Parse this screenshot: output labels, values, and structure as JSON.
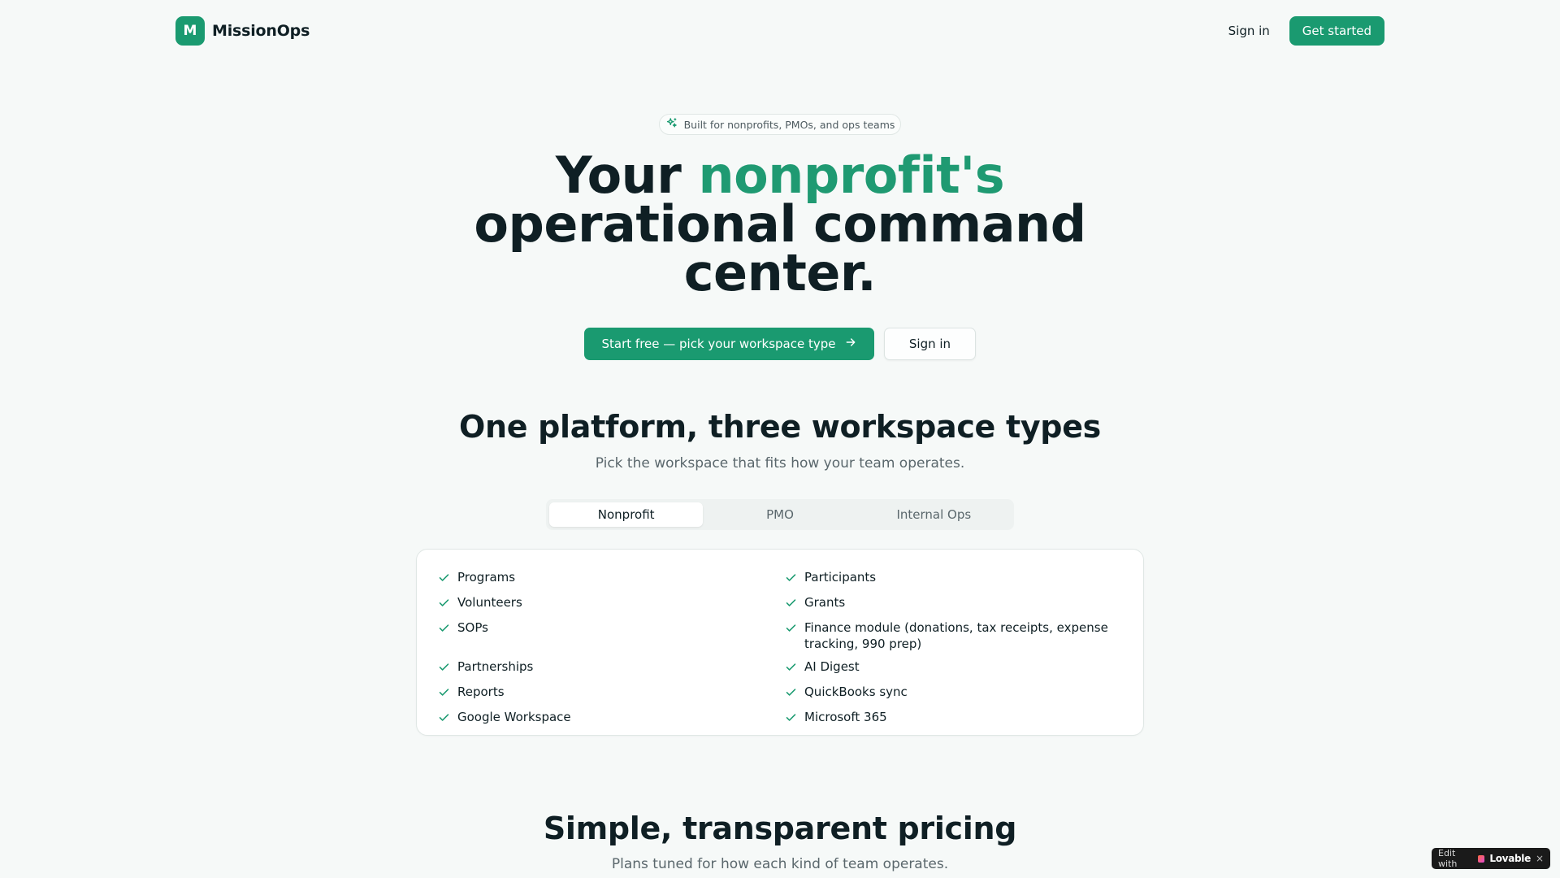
{
  "colors": {
    "accent": "#1a9a70",
    "text": "#0f1f24",
    "muted": "#5a676c",
    "background": "#f6f9f8"
  },
  "header": {
    "brand_initial": "M",
    "brand_name": "MissionOps",
    "sign_in": "Sign in",
    "get_started": "Get started"
  },
  "hero": {
    "badge_icon": "sparkles-icon",
    "badge": "Built for nonprofits, PMOs, and ops teams",
    "title_prefix": "Your ",
    "title_accent": "nonprofit's",
    "title_line2": "operational command",
    "title_line3": "center.",
    "cta_primary": "Start free — pick your workspace type",
    "cta_primary_icon": "arrow-right-icon",
    "cta_secondary": "Sign in"
  },
  "workspace": {
    "title": "One platform, three workspace types",
    "subtitle": "Pick the workspace that fits how your team operates.",
    "tabs": [
      {
        "label": "Nonprofit",
        "active": true
      },
      {
        "label": "PMO",
        "active": false
      },
      {
        "label": "Internal Ops",
        "active": false
      }
    ],
    "feature_icon": "check-icon",
    "features": [
      "Programs",
      "Participants",
      "Volunteers",
      "Grants",
      "SOPs",
      "Finance module (donations, tax receipts, expense tracking, 990 prep)",
      "Partnerships",
      "AI Digest",
      "Reports",
      "QuickBooks sync",
      "Google Workspace",
      "Microsoft 365"
    ]
  },
  "pricing": {
    "title": "Simple, transparent pricing",
    "subtitle": "Plans tuned for how each kind of team operates."
  },
  "lovable_badge": {
    "prefix": "Edit with",
    "name": "Lovable",
    "close": "×"
  }
}
